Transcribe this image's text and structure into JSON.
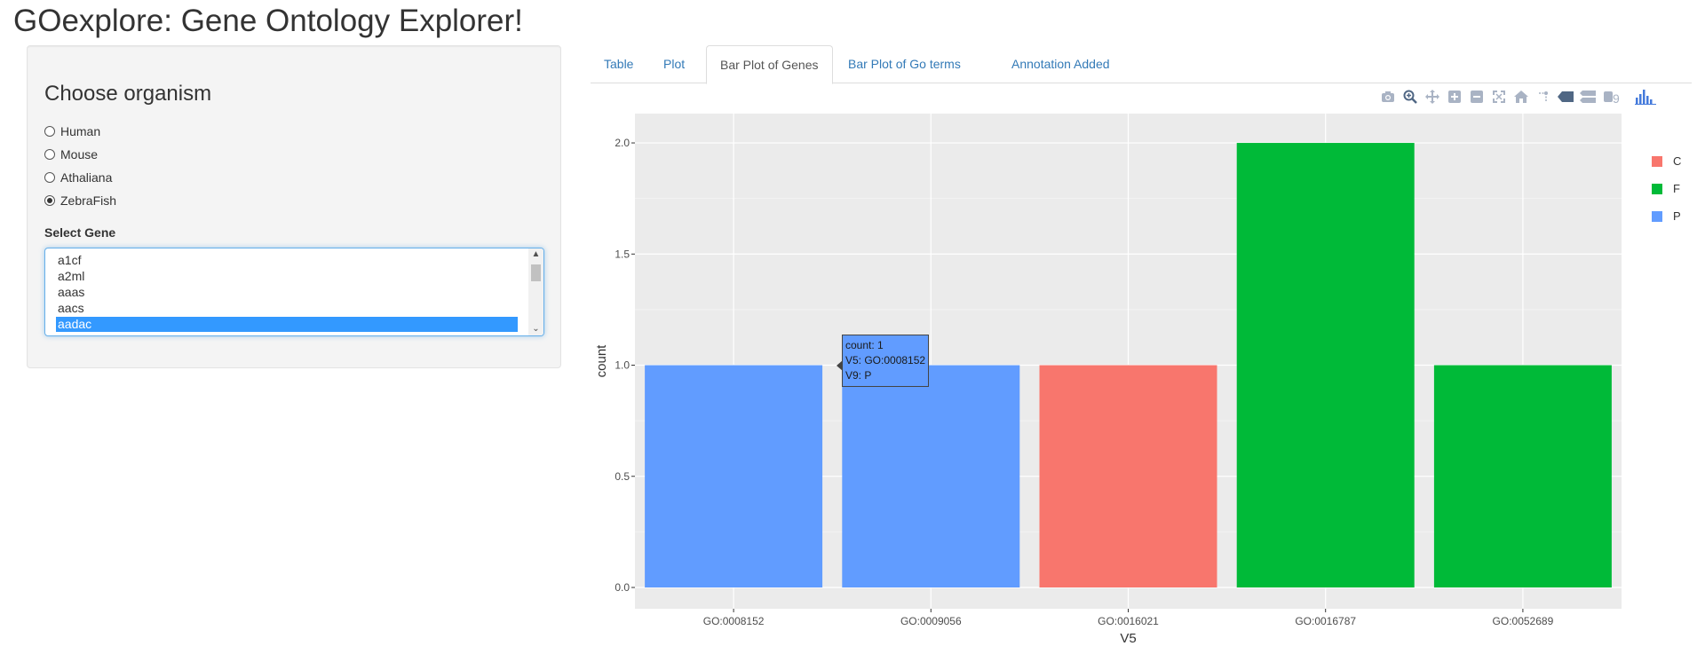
{
  "app": {
    "title": "GOexplore: Gene Ontology Explorer!"
  },
  "sidebar": {
    "heading": "Choose organism",
    "organisms": [
      {
        "label": "Human",
        "checked": false
      },
      {
        "label": "Mouse",
        "checked": false
      },
      {
        "label": "Athaliana",
        "checked": false
      },
      {
        "label": "ZebraFish",
        "checked": true
      }
    ],
    "select_label": "Select Gene",
    "genes": [
      "a1cf",
      "a2ml",
      "aaas",
      "aacs",
      "aadac"
    ],
    "selected_gene": "aadac"
  },
  "tabs": [
    {
      "label": "Table",
      "active": false
    },
    {
      "label": "Plot",
      "active": false
    },
    {
      "label": "Bar Plot of Genes",
      "active": true
    },
    {
      "label": "Bar Plot of Go terms",
      "active": false
    },
    {
      "label": "Annotation Added",
      "active": false
    }
  ],
  "modebar": {
    "icons": [
      "camera-icon",
      "zoom-icon",
      "pan-icon",
      "zoom-in-icon",
      "zoom-out-icon",
      "autoscale-icon",
      "reset-axes-icon",
      "spike-lines-icon",
      "hover-closest-icon",
      "hover-compare-icon",
      "plotly-logo-icon",
      "plotly-bars-icon"
    ]
  },
  "tooltip": {
    "lines": [
      "count: 1",
      "V5: GO:0008152",
      "V9: P"
    ]
  },
  "chart_data": {
    "type": "bar",
    "xlabel": "V5",
    "ylabel": "count",
    "categories": [
      "GO:0008152",
      "GO:0009056",
      "GO:0016021",
      "GO:0016787",
      "GO:0052689"
    ],
    "values": [
      1,
      1,
      1,
      2,
      1
    ],
    "groups": [
      "P",
      "P",
      "C",
      "F",
      "F"
    ],
    "ylim": [
      0,
      2.1
    ],
    "yticks": [
      0.0,
      0.5,
      1.0,
      1.5,
      2.0
    ],
    "ytick_labels": [
      "0.0",
      "0.5",
      "1.0",
      "1.5",
      "2.0"
    ],
    "legend": [
      {
        "name": "C",
        "color": "#f8766d"
      },
      {
        "name": "F",
        "color": "#00ba38"
      },
      {
        "name": "P",
        "color": "#619cff"
      }
    ],
    "legend_position": "right",
    "grid": true,
    "plot_bg": "#ebebeb"
  }
}
